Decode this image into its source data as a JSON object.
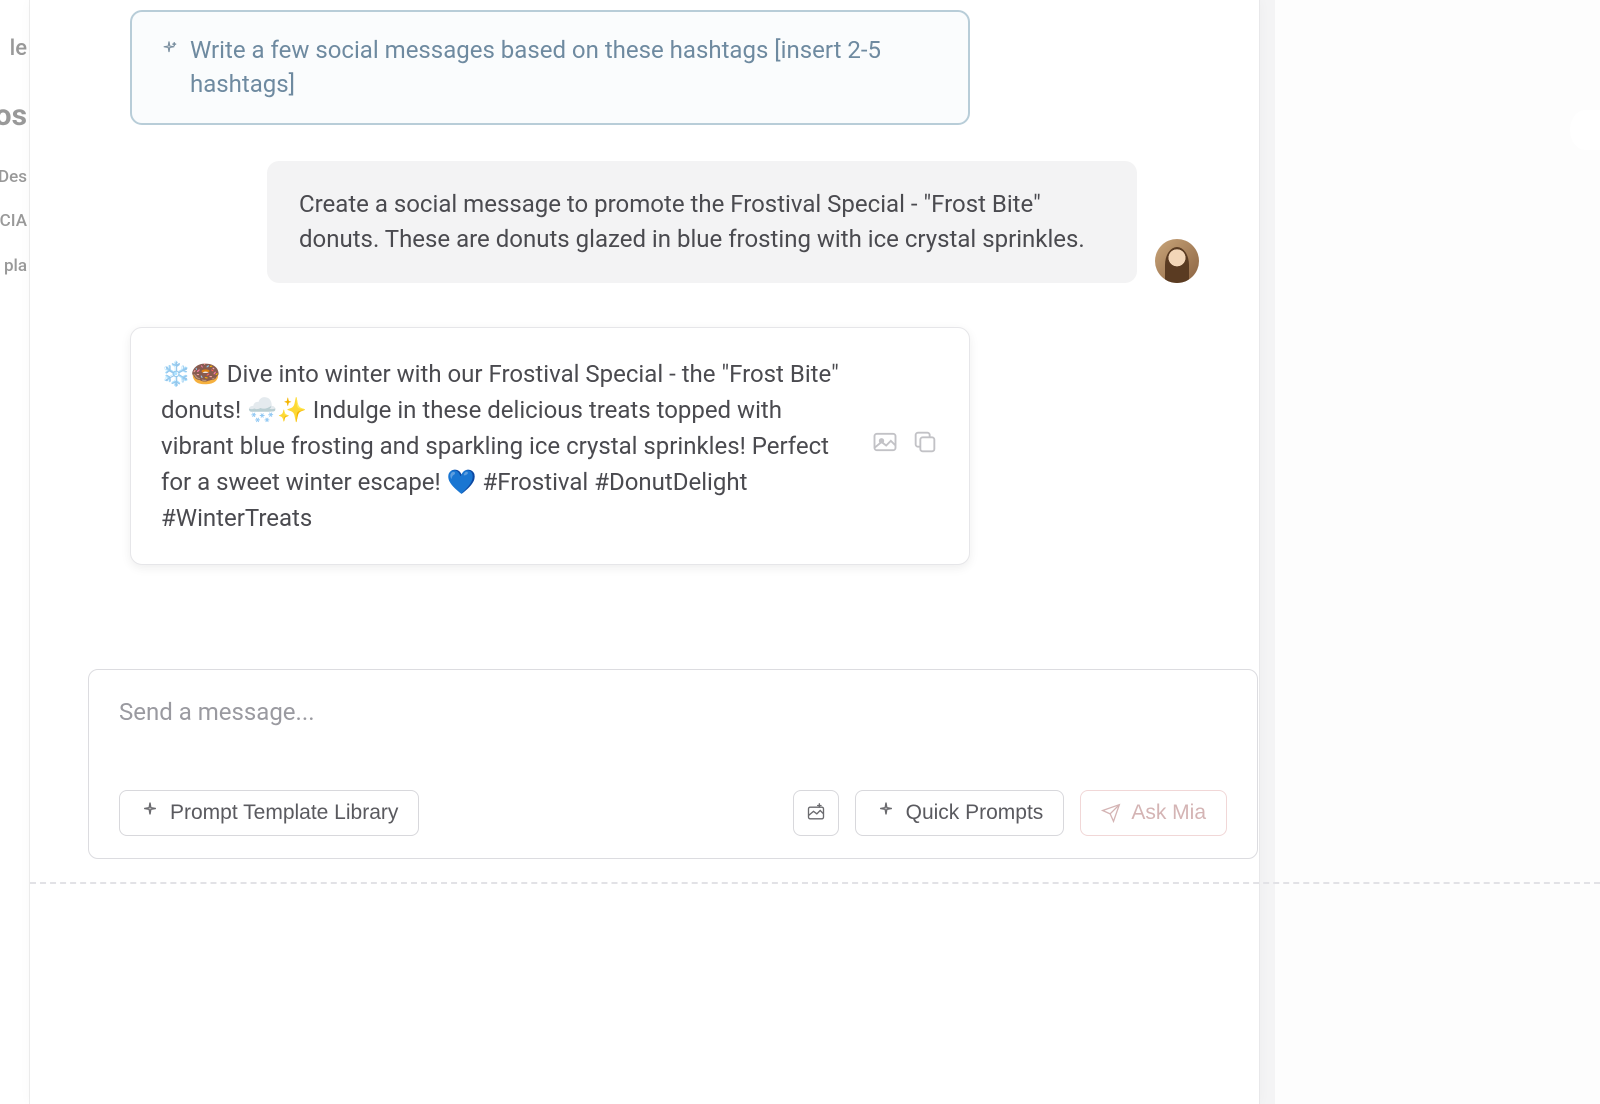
{
  "suggestion": {
    "text": "Write a few social messages based on these hashtags [insert 2-5 hashtags]"
  },
  "user_message": {
    "text": "Create a social message to promote the Frostival Special - \"Frost Bite\" donuts. These are donuts glazed in blue frosting with ice crystal sprinkles."
  },
  "ai_response": {
    "text": "❄️🍩 Dive into winter with our Frostival Special - the \"Frost Bite\" donuts! 🌨️✨ Indulge in these delicious treats topped with vibrant blue frosting and sparkling ice crystal sprinkles! Perfect for a sweet winter escape! 💙 #Frostival #DonutDelight #WinterTreats"
  },
  "composer": {
    "placeholder": "Send a message...",
    "prompt_library_label": "Prompt Template Library",
    "quick_prompts_label": "Quick Prompts",
    "ask_label": "Ask Mia"
  }
}
